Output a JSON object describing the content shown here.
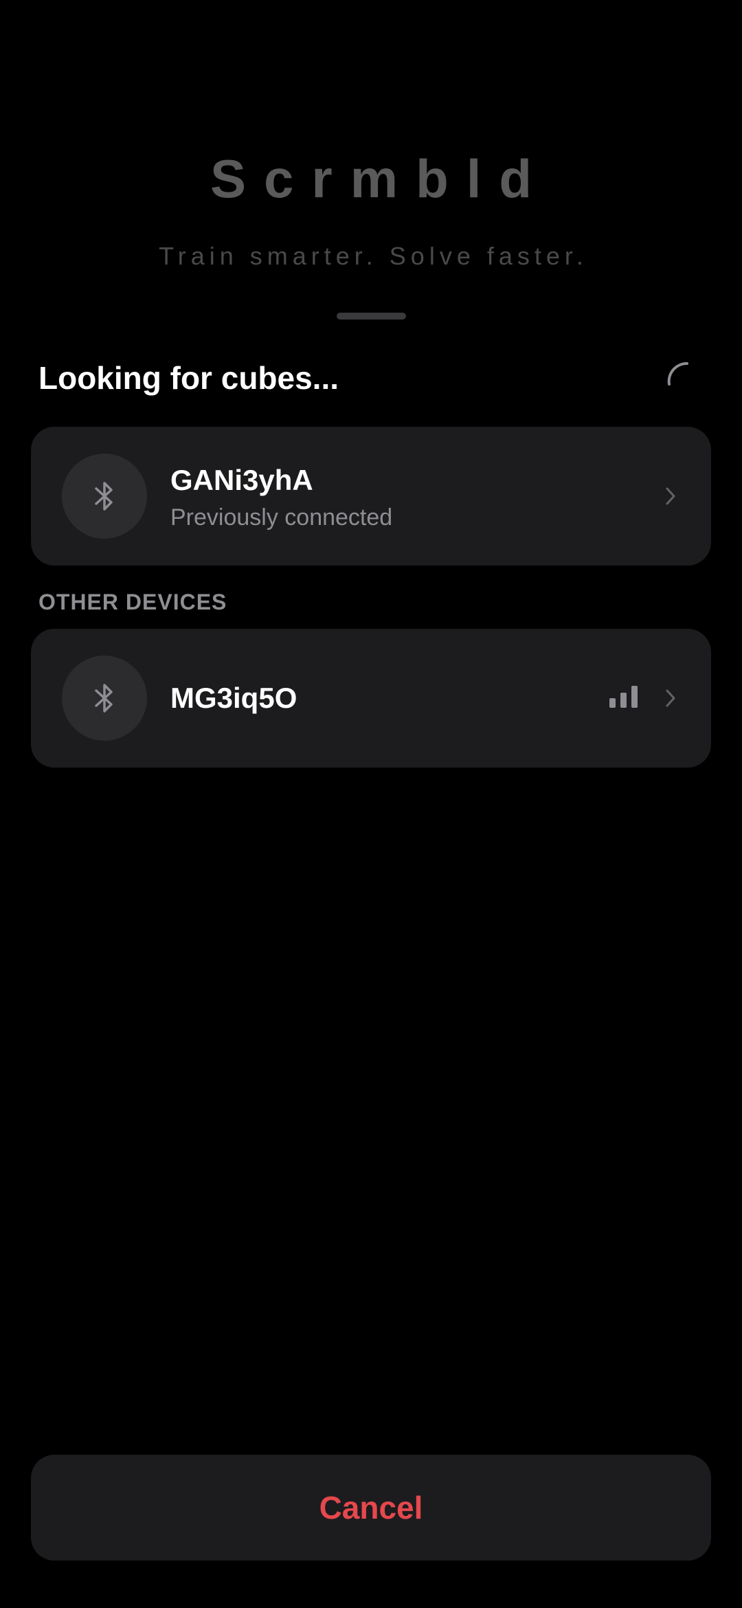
{
  "brand": {
    "title": "Scrmbld",
    "tagline": "Train smarter. Solve faster."
  },
  "scan": {
    "heading": "Looking for cubes..."
  },
  "previous_device": {
    "name": "GANi3yhA",
    "status": "Previously connected",
    "icon": "bluetooth-icon"
  },
  "other_section": {
    "label": "OTHER DEVICES"
  },
  "other_devices": [
    {
      "name": "MG3iq5O",
      "icon": "bluetooth-icon",
      "signal_bars_filled": 3,
      "signal_bars_total": 3
    }
  ],
  "actions": {
    "cancel_label": "Cancel"
  },
  "colors": {
    "background": "#000000",
    "card": "#1c1c1e",
    "icon_circle": "#2c2c2e",
    "secondary_text": "#8e8e93",
    "brand_text": "#5a5a5a",
    "cancel_accent": "#e5484d"
  }
}
